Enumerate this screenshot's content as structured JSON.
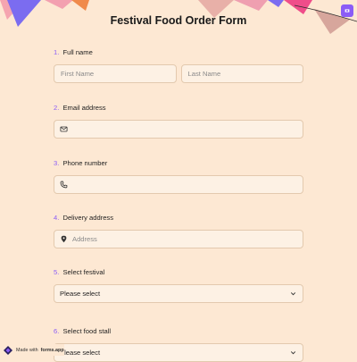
{
  "form": {
    "title": "Festival Food Order Form"
  },
  "questions": {
    "q1": {
      "num": "1.",
      "label": "Full name",
      "first_placeholder": "First Name",
      "last_placeholder": "Last Name"
    },
    "q2": {
      "num": "2.",
      "label": "Email address",
      "placeholder": "",
      "icon": "mail-icon"
    },
    "q3": {
      "num": "3.",
      "label": "Phone number",
      "placeholder": "",
      "icon": "phone-icon"
    },
    "q4": {
      "num": "4.",
      "label": "Delivery address",
      "placeholder": "Address",
      "icon": "location-pin-icon"
    },
    "q5": {
      "num": "5.",
      "label": "Select festival",
      "value": "Please select",
      "icon": "chevron-down-icon"
    },
    "q6": {
      "num": "6.",
      "label": "Select food stall",
      "value": "Please select",
      "icon": "chevron-down-icon"
    }
  },
  "badge": {
    "made_with": "Made with",
    "brand": "forms.app"
  },
  "colors": {
    "background": "#fde8d3",
    "accent": "#8b5cf6",
    "field_bg": "#fdf1e4",
    "field_border": "#e3c9ae"
  }
}
